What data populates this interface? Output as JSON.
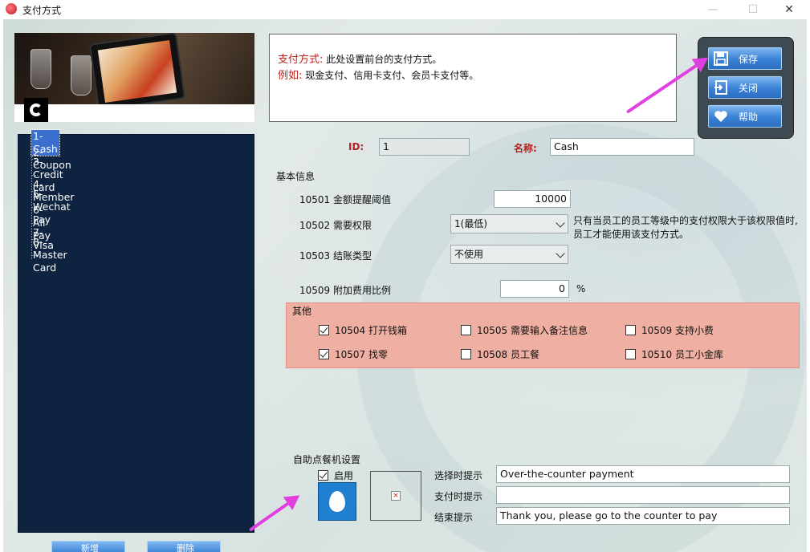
{
  "window": {
    "title": "支付方式",
    "minimize": "—",
    "maximize": "☐",
    "close": "✕"
  },
  "info": {
    "line1_key": "支付方式:",
    "line1_text": "此处设置前台的支付方式。",
    "line2_key": "例如:",
    "line2_text": "现金支付、信用卡支付、会员卡支付等。"
  },
  "actions": {
    "save": "保存",
    "close": "关闭",
    "help": "帮助"
  },
  "tree": {
    "items": [
      {
        "label": "1-Cash",
        "selected": true
      },
      {
        "label": "2-Coupon"
      },
      {
        "label": "3-Credit card"
      },
      {
        "label": "4-Member"
      },
      {
        "label": "5-Wechat Pay"
      },
      {
        "label": "6-Ali Pay"
      },
      {
        "label": "7-Visa"
      },
      {
        "label": "8-Master Card"
      }
    ]
  },
  "form": {
    "id_label": "ID:",
    "id_value": "1",
    "name_label": "名称:",
    "name_value": "Cash",
    "basic_section": "基本信息",
    "f10501_label": "10501 金额提醒阈值",
    "f10501_value": "10000",
    "f10502_label": "10502 需要权限",
    "f10502_value": "1(最低)",
    "f10502_hint1": "只有当员工的员工等级中的支付权限大于该权限值时,",
    "f10502_hint2": "员工才能使用该支付方式。",
    "f10503_label": "10503 结账类型",
    "f10503_value": "不使用",
    "f10509_label": "10509 附加费用比例",
    "f10509_value": "0",
    "f10509_unit": "%"
  },
  "other": {
    "section": "其他",
    "options": [
      {
        "label": "10504 打开钱箱",
        "checked": true
      },
      {
        "label": "10505 需要输入备注信息",
        "checked": false
      },
      {
        "label": "10509 支持小费",
        "checked": false
      },
      {
        "label": "10507 找零",
        "checked": true
      },
      {
        "label": "10508 员工餐",
        "checked": false
      },
      {
        "label": "10510 员工小金库",
        "checked": false
      }
    ]
  },
  "kiosk": {
    "section": "自助点餐机设置",
    "enable_label": "启用",
    "enabled": true,
    "select_prompt_label": "选择时提示",
    "select_prompt_value": "Over-the-counter payment",
    "pay_prompt_label": "支付时提示",
    "pay_prompt_value": "",
    "end_prompt_label": "结束提示",
    "end_prompt_value": "Thank you, please go to the counter to pay"
  },
  "bottom": {
    "add": "新增",
    "delete": "删除"
  },
  "colors": {
    "tree_bg": "#0d2340",
    "accent_red": "#c0201a",
    "other_panel": "#efafa2",
    "button_blue": "#3d85d8",
    "arrow": "#e040e0"
  },
  "icons": [
    "app-icon",
    "save-icon",
    "exit-icon",
    "heart-icon",
    "drop-icon",
    "broken-image-icon",
    "chevron-down-icon"
  ]
}
